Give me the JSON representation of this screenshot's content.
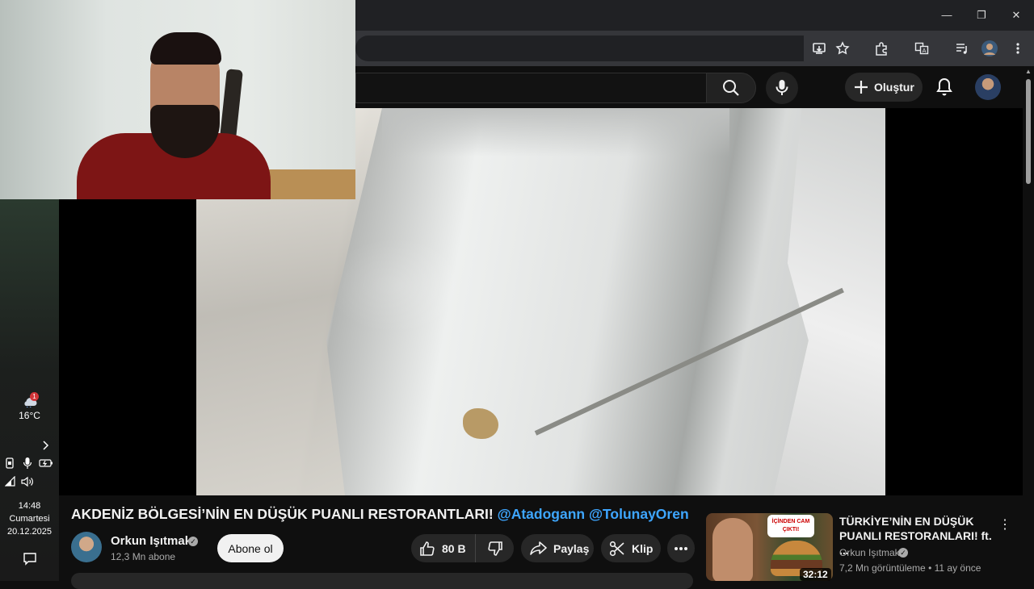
{
  "window": {
    "controls": {
      "minimize": "—",
      "restore": "❐",
      "close": "✕"
    }
  },
  "masthead": {
    "create_label": "Oluştur"
  },
  "video": {
    "title": "AKDENİZ BÖLGESİ’NİN EN DÜŞÜK PUANLI RESTORANTLARI!",
    "mentions": [
      "@Atadogann",
      "@TolunayOren"
    ],
    "channel_name": "Orkun Işıtmak",
    "subscribers": "12,3 Mn abone",
    "subscribe_label": "Abone ol",
    "likes": "80 B",
    "share_label": "Paylaş",
    "clip_label": "Klip"
  },
  "recommended": {
    "title": "TÜRKİYE’NİN EN DÜŞÜK PUANLI RESTORANLARI! ft. ...",
    "channel": "Orkun Işıtmak",
    "meta": "7,2 Mn görüntüleme • 11 ay önce",
    "duration": "32:12",
    "thumb_bubble": "İÇİNDEN CAM ÇIKTI!"
  },
  "taskbar": {
    "temperature": "16°C",
    "weather_badge": "1",
    "time": "14:48",
    "day": "Cumartesi",
    "date": "20.12.2025"
  },
  "colors": {
    "background": "#0f0f0f",
    "mention": "#3ea6ff",
    "pill": "#272727"
  }
}
